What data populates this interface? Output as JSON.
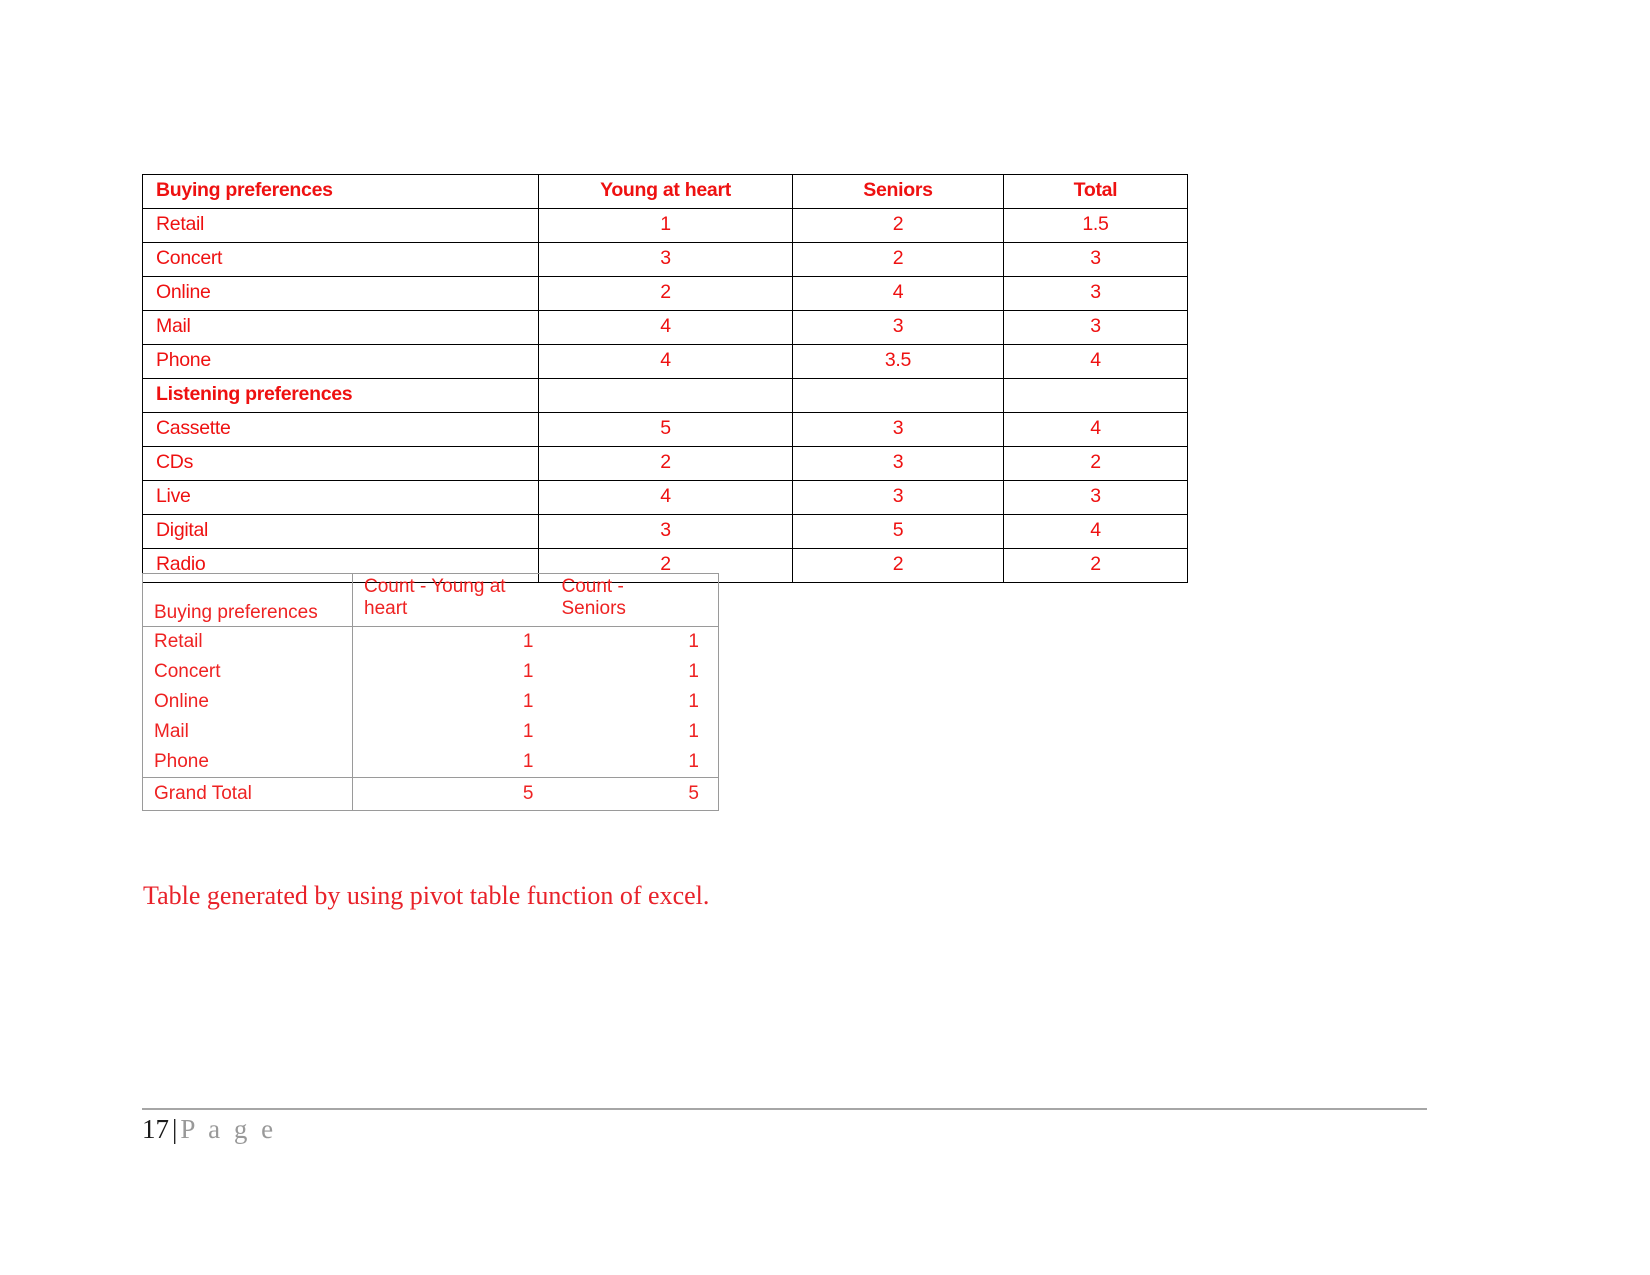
{
  "document": {
    "preferences_table": {
      "columns": [
        "Buying preferences",
        "Young at heart",
        "Seniors",
        "Total"
      ],
      "rows": [
        {
          "label": "Retail",
          "young_at_heart": "1",
          "seniors": "2",
          "total": "1.5",
          "type": "data"
        },
        {
          "label": "Concert",
          "young_at_heart": "3",
          "seniors": "2",
          "total": "3",
          "type": "data"
        },
        {
          "label": "Online",
          "young_at_heart": "2",
          "seniors": "4",
          "total": "3",
          "type": "data"
        },
        {
          "label": "Mail",
          "young_at_heart": "4",
          "seniors": "3",
          "total": "3",
          "type": "data"
        },
        {
          "label": "Phone",
          "young_at_heart": "4",
          "seniors": "3.5",
          "total": "4",
          "type": "data"
        },
        {
          "label": "Listening preferences",
          "young_at_heart": "",
          "seniors": "",
          "total": "",
          "type": "section"
        },
        {
          "label": "Cassette",
          "young_at_heart": "5",
          "seniors": "3",
          "total": "4",
          "type": "data"
        },
        {
          "label": "CDs",
          "young_at_heart": "2",
          "seniors": "3",
          "total": "2",
          "type": "data"
        },
        {
          "label": "Live",
          "young_at_heart": "4",
          "seniors": "3",
          "total": "3",
          "type": "data"
        },
        {
          "label": "Digital",
          "young_at_heart": "3",
          "seniors": "5",
          "total": "4",
          "type": "data"
        },
        {
          "label": "Radio",
          "young_at_heart": "2",
          "seniors": "2",
          "total": "2",
          "type": "data"
        }
      ]
    },
    "pivot_table": {
      "columns": [
        "Buying preferences",
        "Count - Young at heart",
        "Count - Seniors"
      ],
      "header_col1": "Buying preferences",
      "header_col2_line1": "Count - Young at",
      "header_col2_line2": "heart",
      "header_col3_line1": "Count -",
      "header_col3_line2": "Seniors",
      "rows": [
        {
          "label": "Retail",
          "count_young_at_heart": "1",
          "count_seniors": "1"
        },
        {
          "label": "Concert",
          "count_young_at_heart": "1",
          "count_seniors": "1"
        },
        {
          "label": "Online",
          "count_young_at_heart": "1",
          "count_seniors": "1"
        },
        {
          "label": "Mail",
          "count_young_at_heart": "1",
          "count_seniors": "1"
        },
        {
          "label": "Phone",
          "count_young_at_heart": "1",
          "count_seniors": "1"
        }
      ],
      "grand_total": {
        "label": "Grand Total",
        "count_young_at_heart": "5",
        "count_seniors": "5"
      }
    },
    "caption": "Table generated by using pivot table function of excel.",
    "footer": {
      "page_number": "17",
      "separator": "|",
      "page_word": "P a g e"
    },
    "colors": {
      "table_text_red": "#ee1111",
      "pivot_text_red": "#ee2222",
      "caption_red": "#e8222a",
      "table1_border": "#000000",
      "table2_border": "#9a9a9a",
      "footer_rule": "#a6a6a6",
      "footer_word": "#999999"
    }
  }
}
